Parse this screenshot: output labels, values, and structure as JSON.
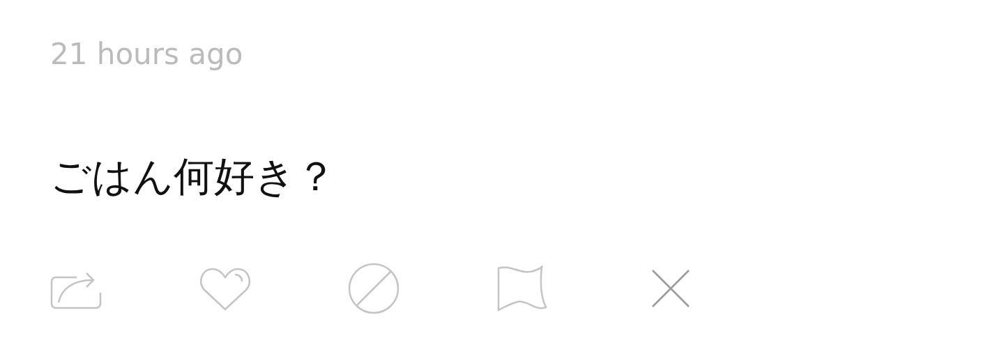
{
  "timestamp": "21 hours ago",
  "question": "ごはん何好き？",
  "actions": [
    {
      "kind": "share"
    },
    {
      "kind": "like"
    },
    {
      "kind": "block"
    },
    {
      "kind": "report"
    },
    {
      "kind": "dismiss"
    }
  ]
}
